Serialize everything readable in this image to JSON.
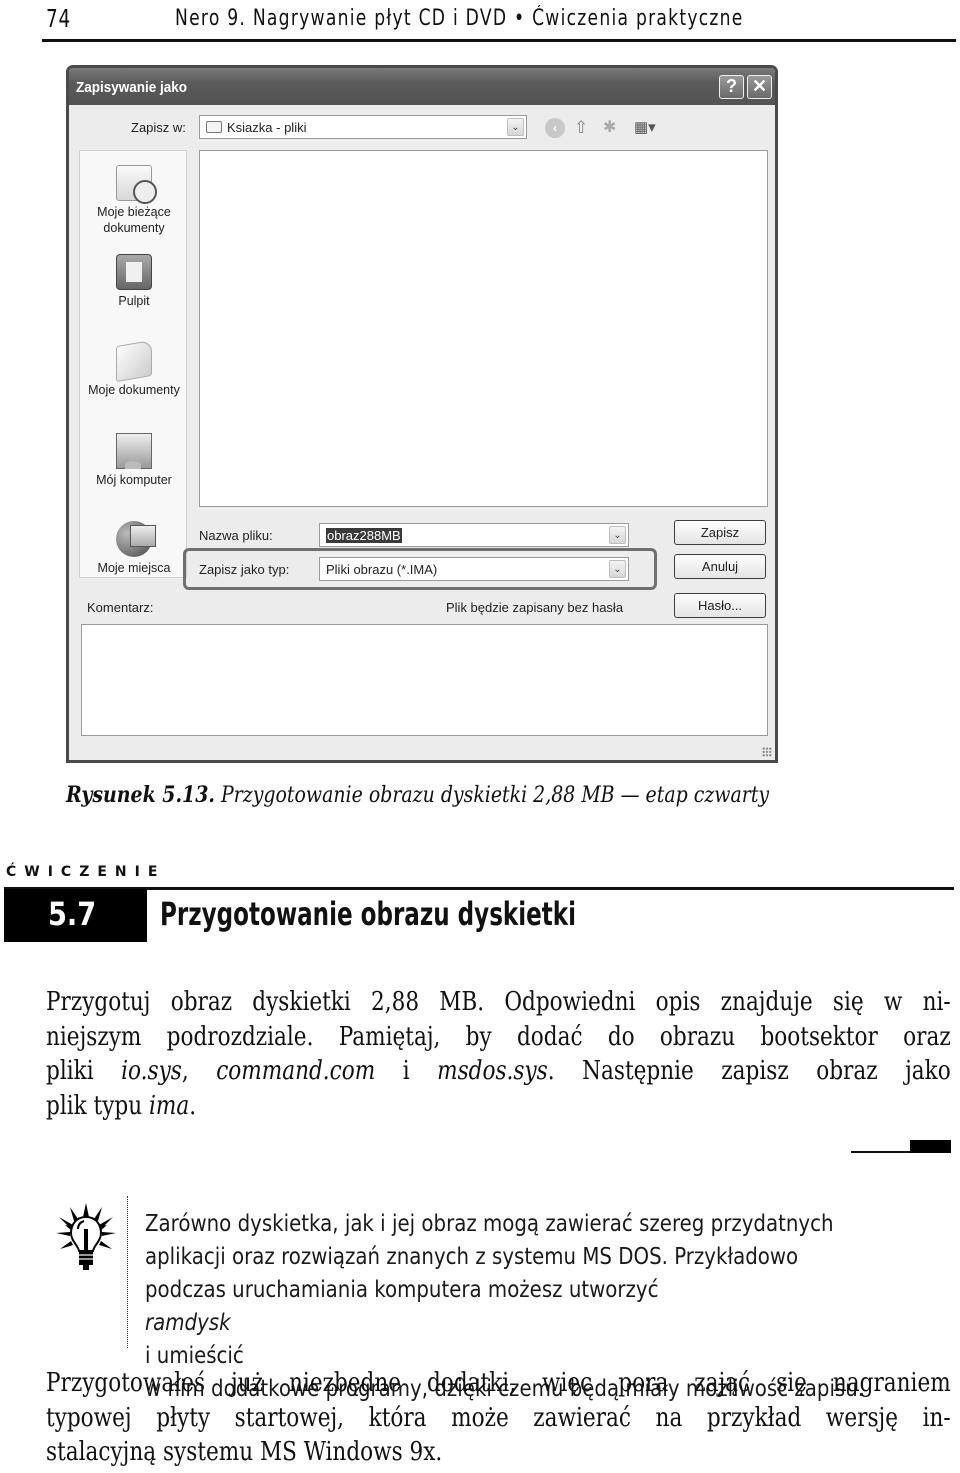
{
  "running_header": {
    "page_number": "74",
    "book_title": "Nero 9. Nagrywanie płyt CD i DVD • Ćwiczenia praktyczne"
  },
  "dialog": {
    "title": "Zapisywanie jako",
    "help_button": "?",
    "close_button": "✕",
    "save_in_label": "Zapisz w:",
    "save_in_value": "Ksiazka - pliki",
    "toolbar_icons": [
      "back-icon",
      "up-folder-icon",
      "new-folder-icon",
      "views-menu-icon"
    ],
    "places": [
      {
        "label_line1": "Moje bieżące",
        "label_line2": "dokumenty",
        "icon": "recent-documents-icon"
      },
      {
        "label_line1": "Pulpit",
        "label_line2": "",
        "icon": "desktop-icon"
      },
      {
        "label_line1": "Moje dokumenty",
        "label_line2": "",
        "icon": "my-documents-icon"
      },
      {
        "label_line1": "Mój komputer",
        "label_line2": "",
        "icon": "my-computer-icon"
      },
      {
        "label_line1": "Moje miejsca",
        "label_line2": "",
        "icon": "network-places-icon"
      }
    ],
    "filename_label": "Nazwa pliku:",
    "filename_value": "obraz288MB",
    "filetype_label": "Zapisz jako typ:",
    "filetype_value": "Pliki obrazu (*.IMA)",
    "save_button": "Zapisz",
    "cancel_button": "Anuluj",
    "password_button": "Hasło...",
    "comment_label": "Komentarz:",
    "comment_value": "",
    "password_status": "Plik będzie zapisany bez hasła",
    "dropdown_arrow": "⌄"
  },
  "caption": {
    "label": "Rysunek 5.13.",
    "text": "Przygotowanie obrazu dyskietki 2,88 MB — etap czwarty"
  },
  "exercise": {
    "kicker": "ĆWICZENIE",
    "number": "5.7",
    "title": "Przygotowanie obrazu dyskietki"
  },
  "paragraph1": {
    "line1": "Przygotuj obraz dyskietki 2,88 MB. Odpowiedni opis znajduje się w ni-",
    "line2": "niejszym podrozdziale. Pamiętaj, by dodać do obrazu bootsektor oraz",
    "line3_a": "pliki ",
    "line3_em1": "io.sys",
    "line3_b": ", ",
    "line3_em2": "command.com",
    "line3_c": " i ",
    "line3_em3": "msdos.sys",
    "line3_d": ". Następnie zapisz obraz jako",
    "line4_a": "plik typu ",
    "line4_em": "ima",
    "line4_b": "."
  },
  "tip": {
    "icon": "lightbulb-icon",
    "line1": "Zarówno dyskietka, jak i jej obraz mogą zawierać szereg przydatnych",
    "line2": "aplikacji oraz rozwiązań znanych z systemu MS DOS. Przykładowo",
    "line3_a": "podczas uruchamiania komputera możesz utworzyć ",
    "line3_em": "ramdysk",
    "line3_b": " i umieścić",
    "line4": "w nim dodatkowe programy, dzięki czemu będą miały możliwość zapisu."
  },
  "paragraph2": {
    "line1": "Przygotowałeś już niezbędne dodatki, więc pora zająć się nagraniem",
    "line2": "typowej płyty startowej, która może zawierać na przykład wersję in-",
    "line3": "stalacyjną systemu MS Windows 9x."
  }
}
